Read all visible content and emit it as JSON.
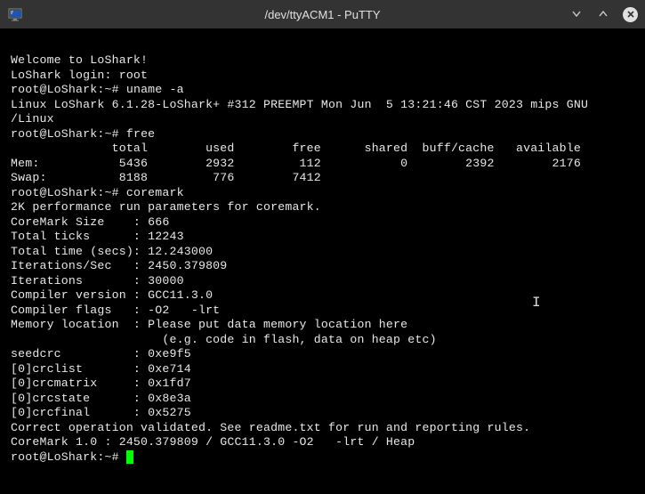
{
  "titlebar": {
    "title": "/dev/ttyACM1 - PuTTY"
  },
  "terminal": {
    "welcome": "Welcome to LoShark!",
    "login_line": "LoShark login: root",
    "prompt": "root@LoShark:~#",
    "cmd_uname": "uname -a",
    "uname_out1": "Linux LoShark 6.1.28-LoShark+ #312 PREEMPT Mon Jun  5 13:21:46 CST 2023 mips GNU",
    "uname_out2": "/Linux",
    "cmd_free": "free",
    "free_header": "              total        used        free      shared  buff/cache   available",
    "free_mem": "Mem:           5436        2932         112           0        2392        2176",
    "free_swap": "Swap:          8188         776        7412",
    "cmd_coremark": "coremark",
    "cm_line1": "2K performance run parameters for coremark.",
    "cm_size": "CoreMark Size    : 666",
    "cm_ticks": "Total ticks      : 12243",
    "cm_time": "Total time (secs): 12.243000",
    "cm_iters": "Iterations/Sec   : 2450.379809",
    "cm_iter": "Iterations       : 30000",
    "cm_comp": "Compiler version : GCC11.3.0",
    "cm_flags": "Compiler flags   : -O2   -lrt",
    "cm_mem1": "Memory location  : Please put data memory location here",
    "cm_mem2": "                     (e.g. code in flash, data on heap etc)",
    "cm_seed": "seedcrc          : 0xe9f5",
    "cm_crc1": "[0]crclist       : 0xe714",
    "cm_crc2": "[0]crcmatrix     : 0x1fd7",
    "cm_crc3": "[0]crcstate      : 0x8e3a",
    "cm_crc4": "[0]crcfinal      : 0x5275",
    "cm_valid": "Correct operation validated. See readme.txt for run and reporting rules.",
    "cm_result": "CoreMark 1.0 : 2450.379809 / GCC11.3.0 -O2   -lrt / Heap"
  }
}
